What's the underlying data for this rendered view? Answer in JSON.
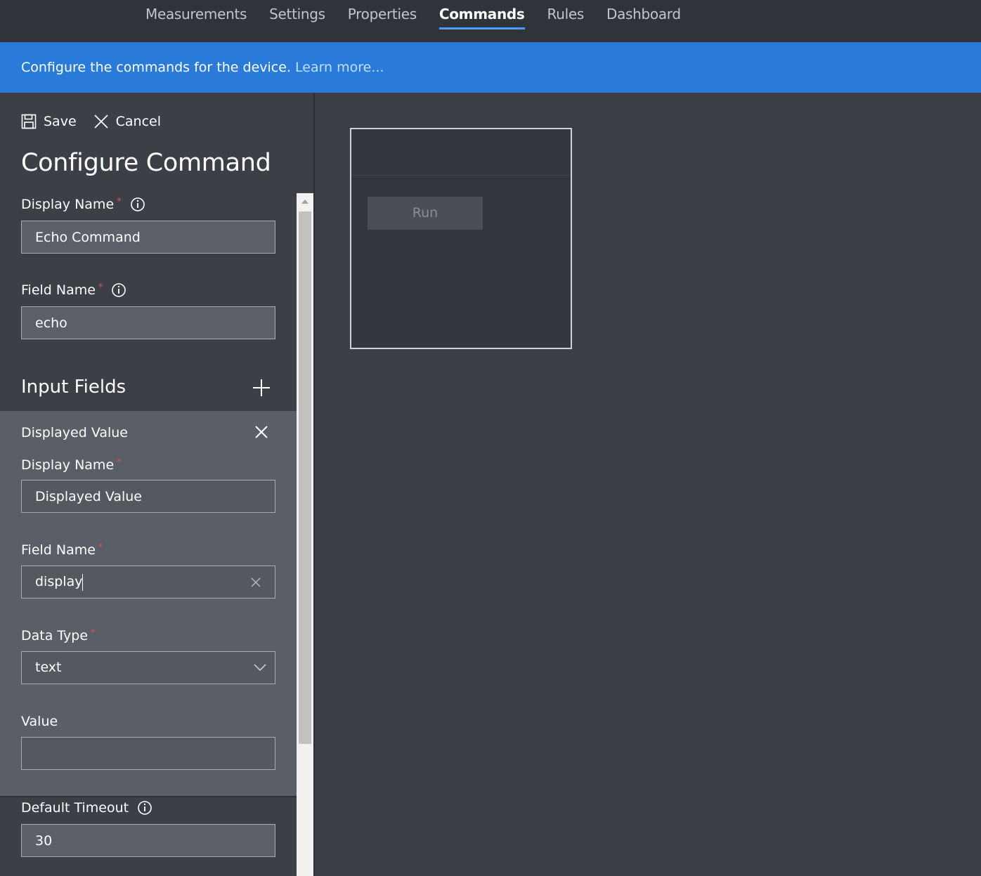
{
  "tabs": [
    {
      "label": "Measurements",
      "active": false
    },
    {
      "label": "Settings",
      "active": false
    },
    {
      "label": "Properties",
      "active": false
    },
    {
      "label": "Commands",
      "active": true
    },
    {
      "label": "Rules",
      "active": false
    },
    {
      "label": "Dashboard",
      "active": false
    }
  ],
  "banner": {
    "text": "Configure the commands for the device.",
    "link": "Learn more..."
  },
  "toolbar": {
    "save_label": "Save",
    "cancel_label": "Cancel"
  },
  "panel": {
    "title": "Configure Command",
    "display_name_label": "Display Name",
    "display_name_value": "Echo Command",
    "field_name_label": "Field Name",
    "field_name_value": "echo",
    "input_fields_title": "Input Fields",
    "default_timeout_label": "Default Timeout",
    "default_timeout_value": "30",
    "required_mark": "*"
  },
  "input_field": {
    "header": "Displayed Value",
    "display_name_label": "Display Name",
    "display_name_value": "Displayed Value",
    "field_name_label": "Field Name",
    "field_name_value": "display",
    "data_type_label": "Data Type",
    "data_type_value": "text",
    "value_label": "Value",
    "value_value": ""
  },
  "preview": {
    "run_label": "Run"
  },
  "colors": {
    "accent": "#4a9eff",
    "banner": "#2a7ad9",
    "required": "#e05050"
  }
}
